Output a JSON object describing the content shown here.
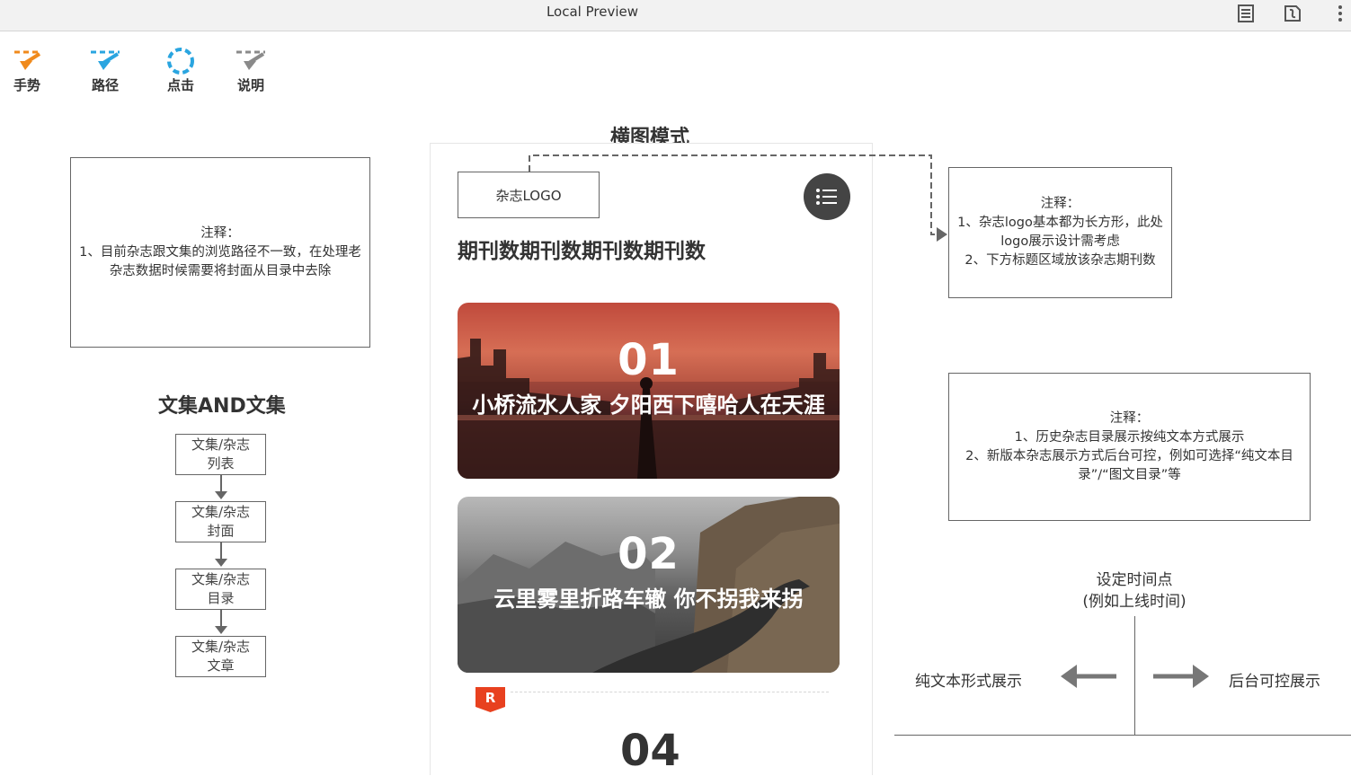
{
  "window": {
    "title": "Local Preview",
    "icons": [
      "document-icon",
      "export-icon",
      "more-vert-icon"
    ]
  },
  "toolbar": {
    "gesture": "手势",
    "path": "路径",
    "click": "点击",
    "explain": "说明"
  },
  "notes": {
    "left": "注释：\n1、目前杂志跟文集的浏览路径不一致，在处理老杂志数据时候需要将封面从目录中去除",
    "right_top": "注释：\n1、杂志logo基本都为长方形，此处logo展示设计需考虑\n2、下方标题区域放该杂志期刊数",
    "right_middle": "注释：\n1、历史杂志目录展示按纯文本方式展示\n2、新版本杂志展示方式后台可控，例如可选择“纯文本目录”/“图文目录”等"
  },
  "flow": {
    "heading": "文集AND文集",
    "steps": [
      "文集/杂志\n列表",
      "文集/杂志\n封面",
      "文集/杂志\n目录",
      "文集/杂志\n文章"
    ]
  },
  "phone": {
    "heading": "横图模式",
    "logo_label": "杂志LOGO",
    "issue_title": "期刊数期刊数期刊数期刊数",
    "cards": [
      {
        "num": "01",
        "caption": "小桥流水人家 夕阳西下嘻哈人在天涯"
      },
      {
        "num": "02",
        "caption": "云里雾里折路车辙 你不拐我来拐"
      }
    ],
    "badge": "R",
    "next_num": "04"
  },
  "timeline": {
    "center": "设定时间点\n(例如上线时间)",
    "left": "纯文本形式展示",
    "right": "后台可控展示"
  },
  "colors": {
    "orange": "#f08a1c",
    "blue": "#2aa5e0",
    "gray": "#8a8a8a",
    "badge": "#e8411f"
  }
}
